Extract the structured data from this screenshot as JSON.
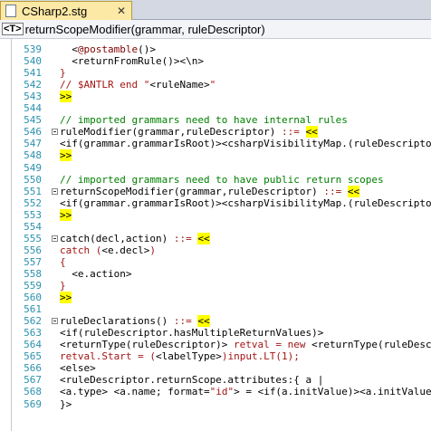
{
  "tab": {
    "title": "CSharp2.stg",
    "close_glyph": "✕"
  },
  "navbar": {
    "icon_text": "<T>",
    "text": "returnScopeModifier(grammar, ruleDescriptor)"
  },
  "colors": {
    "line_number": "#2b91af",
    "comment": "#008000",
    "keyword_red": "#a31515",
    "highlight": "#ffff00"
  },
  "lines": [
    {
      "n": "539",
      "fold": false,
      "segs": [
        {
          "t": "  <",
          "c": "black"
        },
        {
          "t": "@postamble",
          "c": "maroon"
        },
        {
          "t": "()>",
          "c": "black"
        }
      ]
    },
    {
      "n": "540",
      "fold": false,
      "segs": [
        {
          "t": "  <returnFromRule()><\\n>",
          "c": "black"
        }
      ]
    },
    {
      "n": "541",
      "fold": false,
      "segs": [
        {
          "t": "}",
          "c": "red"
        }
      ]
    },
    {
      "n": "542",
      "fold": false,
      "segs": [
        {
          "t": "// $ANTLR end \"",
          "c": "red"
        },
        {
          "t": "<ruleName>",
          "c": "black"
        },
        {
          "t": "\"",
          "c": "red"
        }
      ]
    },
    {
      "n": "543",
      "fold": false,
      "segs": [
        {
          "t": ">>",
          "c": "black",
          "hl": true
        }
      ]
    },
    {
      "n": "544",
      "fold": false,
      "segs": []
    },
    {
      "n": "545",
      "fold": false,
      "segs": [
        {
          "t": "// imported grammars need to have internal rules",
          "c": "green"
        }
      ]
    },
    {
      "n": "546",
      "fold": true,
      "segs": [
        {
          "t": "ruleModifier(grammar,ruleDescriptor) ",
          "c": "black"
        },
        {
          "t": "::=",
          "c": "red"
        },
        {
          "t": " ",
          "c": "black"
        },
        {
          "t": "<<",
          "c": "black",
          "hl": true
        }
      ]
    },
    {
      "n": "547",
      "fold": false,
      "segs": [
        {
          "t": "<if(grammar.grammarIsRoot)><csharpVisibilityMap.(ruleDescriptor.modifier)",
          "c": "black"
        }
      ]
    },
    {
      "n": "548",
      "fold": false,
      "segs": [
        {
          "t": ">>",
          "c": "black",
          "hl": true
        }
      ]
    },
    {
      "n": "549",
      "fold": false,
      "segs": []
    },
    {
      "n": "550",
      "fold": false,
      "segs": [
        {
          "t": "// imported grammars need to have public return scopes",
          "c": "green"
        }
      ]
    },
    {
      "n": "551",
      "fold": true,
      "segs": [
        {
          "t": "returnScopeModifier(grammar,ruleDescriptor) ",
          "c": "black"
        },
        {
          "t": "::=",
          "c": "red"
        },
        {
          "t": " ",
          "c": "black"
        },
        {
          "t": "<<",
          "c": "black",
          "hl": true
        }
      ]
    },
    {
      "n": "552",
      "fold": false,
      "segs": [
        {
          "t": "<if(grammar.grammarIsRoot)><csharpVisibilityMap.(ruleDescriptor.modifier)",
          "c": "black"
        }
      ]
    },
    {
      "n": "553",
      "fold": false,
      "segs": [
        {
          "t": ">>",
          "c": "black",
          "hl": true
        }
      ]
    },
    {
      "n": "554",
      "fold": false,
      "segs": []
    },
    {
      "n": "555",
      "fold": true,
      "segs": [
        {
          "t": "catch(decl,action) ",
          "c": "black"
        },
        {
          "t": "::=",
          "c": "red"
        },
        {
          "t": " ",
          "c": "black"
        },
        {
          "t": "<<",
          "c": "black",
          "hl": true
        }
      ]
    },
    {
      "n": "556",
      "fold": false,
      "segs": [
        {
          "t": "catch (",
          "c": "red"
        },
        {
          "t": "<e.decl>",
          "c": "black"
        },
        {
          "t": ")",
          "c": "red"
        }
      ]
    },
    {
      "n": "557",
      "fold": false,
      "segs": [
        {
          "t": "{",
          "c": "red"
        }
      ]
    },
    {
      "n": "558",
      "fold": false,
      "segs": [
        {
          "t": "  <e.action>",
          "c": "black"
        }
      ]
    },
    {
      "n": "559",
      "fold": false,
      "segs": [
        {
          "t": "}",
          "c": "red"
        }
      ]
    },
    {
      "n": "560",
      "fold": false,
      "segs": [
        {
          "t": ">>",
          "c": "black",
          "hl": true
        }
      ]
    },
    {
      "n": "561",
      "fold": false,
      "segs": []
    },
    {
      "n": "562",
      "fold": true,
      "segs": [
        {
          "t": "ruleDeclarations() ",
          "c": "black"
        },
        {
          "t": "::=",
          "c": "red"
        },
        {
          "t": " ",
          "c": "black"
        },
        {
          "t": "<<",
          "c": "black",
          "hl": true
        }
      ]
    },
    {
      "n": "563",
      "fold": false,
      "segs": [
        {
          "t": "<if(ruleDescriptor.hasMultipleReturnValues)>",
          "c": "black"
        }
      ]
    },
    {
      "n": "564",
      "fold": false,
      "segs": [
        {
          "t": "<returnType(ruleDescriptor)>",
          "c": "black"
        },
        {
          "t": " retval = new ",
          "c": "red"
        },
        {
          "t": "<returnType(ruleDescriptor)>",
          "c": "black"
        },
        {
          "t": "();",
          "c": "red"
        }
      ]
    },
    {
      "n": "565",
      "fold": false,
      "segs": [
        {
          "t": "retval.Start = (",
          "c": "red"
        },
        {
          "t": "<labelType>",
          "c": "black"
        },
        {
          "t": ")input.LT(1);",
          "c": "red"
        }
      ]
    },
    {
      "n": "566",
      "fold": false,
      "segs": [
        {
          "t": "<else>",
          "c": "black"
        }
      ]
    },
    {
      "n": "567",
      "fold": false,
      "segs": [
        {
          "t": "<ruleDescriptor.returnScope.attributes:{ a |",
          "c": "black"
        }
      ]
    },
    {
      "n": "568",
      "fold": false,
      "segs": [
        {
          "t": "<a.type> <a.name; format=",
          "c": "black"
        },
        {
          "t": "\"id\"",
          "c": "red"
        },
        {
          "t": "> = <if(a.initValue)><a.initValue><else><initValue(a.type)>",
          "c": "black"
        }
      ]
    },
    {
      "n": "569",
      "fold": false,
      "segs": [
        {
          "t": "}>",
          "c": "black"
        }
      ]
    }
  ]
}
